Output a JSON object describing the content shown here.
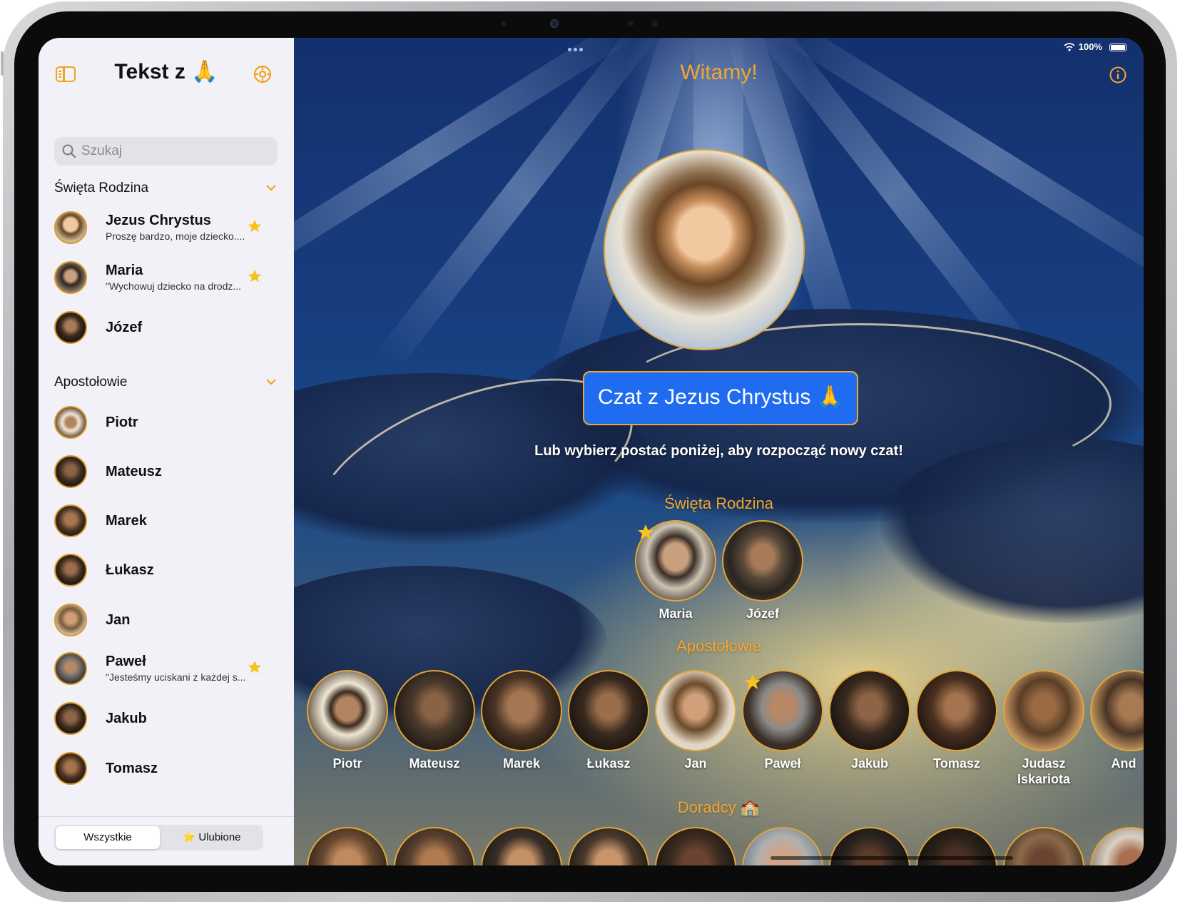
{
  "sidebar": {
    "title": "Tekst z 🙏",
    "search_placeholder": "Szukaj",
    "sections": [
      {
        "title": "Święta Rodzina",
        "items": [
          {
            "name": "Jezus Chrystus",
            "preview": "Proszę bardzo, moje dziecko....",
            "favorite": true
          },
          {
            "name": "Maria",
            "preview": "\"Wychowuj dziecko na drodz...",
            "favorite": true
          },
          {
            "name": "Józef",
            "preview": "",
            "favorite": false
          }
        ]
      },
      {
        "title": "Apostołowie",
        "items": [
          {
            "name": "Piotr",
            "preview": "",
            "favorite": false
          },
          {
            "name": "Mateusz",
            "preview": "",
            "favorite": false
          },
          {
            "name": "Marek",
            "preview": "",
            "favorite": false
          },
          {
            "name": "Łukasz",
            "preview": "",
            "favorite": false
          },
          {
            "name": "Jan",
            "preview": "",
            "favorite": false
          },
          {
            "name": "Paweł",
            "preview": "\"Jesteśmy uciskani z każdej s...",
            "favorite": true
          },
          {
            "name": "Jakub",
            "preview": "",
            "favorite": false
          },
          {
            "name": "Tomasz",
            "preview": "",
            "favorite": false
          }
        ]
      }
    ],
    "filter": {
      "all_label": "Wszystkie",
      "favorites_label": "⭐ Ulubione",
      "selected": "Wszystkie"
    }
  },
  "status_bar": {
    "battery": "100%"
  },
  "main": {
    "title": "Witamy!",
    "chat_button": "Czat z Jezus Chrystus 🙏",
    "subtitle": "Lub wybierz postać poniżej, aby rozpocząć nowy czat!",
    "categories": [
      {
        "title": "Święta Rodzina",
        "characters": [
          {
            "name": "Maria",
            "favorite": true
          },
          {
            "name": "Józef",
            "favorite": false
          }
        ]
      },
      {
        "title": "Apostołowie",
        "characters": [
          {
            "name": "Piotr",
            "favorite": false
          },
          {
            "name": "Mateusz",
            "favorite": false
          },
          {
            "name": "Marek",
            "favorite": false
          },
          {
            "name": "Łukasz",
            "favorite": false
          },
          {
            "name": "Jan",
            "favorite": false
          },
          {
            "name": "Paweł",
            "favorite": true
          },
          {
            "name": "Jakub",
            "favorite": false
          },
          {
            "name": "Tomasz",
            "favorite": false
          },
          {
            "name": "Judasz Iskariota",
            "favorite": false
          },
          {
            "name": "And",
            "favorite": false
          }
        ]
      },
      {
        "title": "Doradcy 🏫",
        "characters": []
      }
    ]
  },
  "colors": {
    "accent": "#f4a72c",
    "button_blue": "#1f6cf0",
    "star": "#f7c31a"
  },
  "icons": [
    "sidebar-toggle-icon",
    "settings-gear-icon",
    "search-icon",
    "chevron-down-icon",
    "star-icon",
    "info-icon",
    "wifi-icon",
    "battery-icon"
  ]
}
